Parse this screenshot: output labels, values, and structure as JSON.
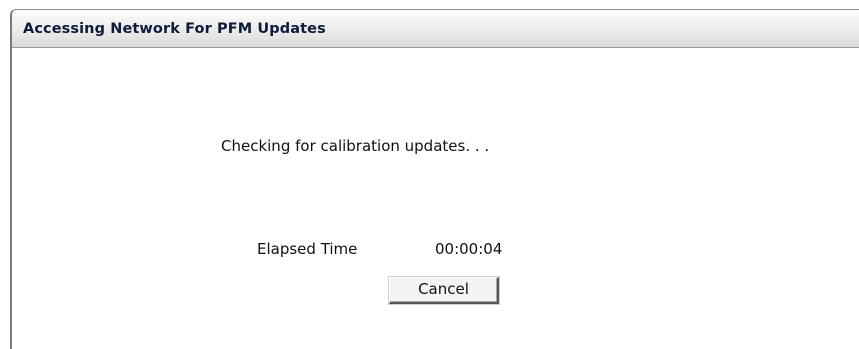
{
  "window": {
    "title": "Accessing Network For PFM Updates"
  },
  "dialog": {
    "status_message": "Checking for calibration updates. . .",
    "elapsed_label": "Elapsed Time",
    "elapsed_value": "00:00:04",
    "cancel_label": "Cancel"
  },
  "colors": {
    "title_text": "#0e1b3a",
    "background": "#ffffff",
    "titlebar_top": "#fdfdfd",
    "titlebar_bottom": "#d9d9d9"
  }
}
